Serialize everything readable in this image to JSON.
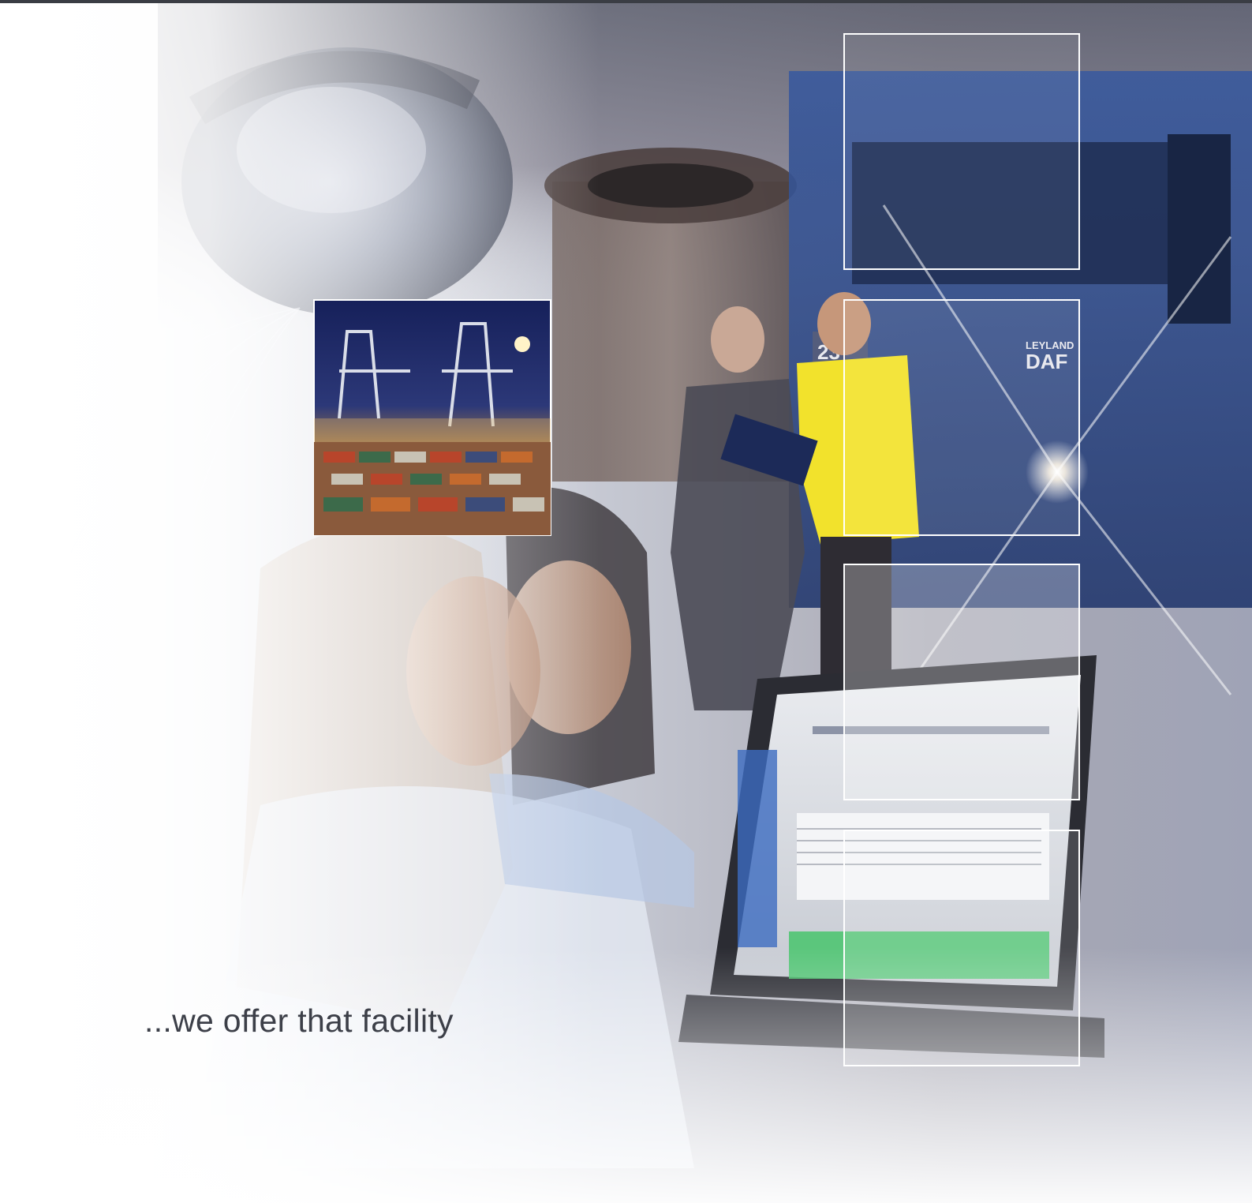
{
  "tagline": "...we offer that facility",
  "truck_badge": {
    "line1": "LEYLAND",
    "line2": "DAF"
  },
  "truck_number": "23",
  "photos": [
    "welder-photo",
    "container-port-photo",
    "truck-night-photo",
    "businessmen-photo",
    "office-workers-photo",
    "computer-monitor-photo"
  ],
  "colors": {
    "rule": "#3a3d44",
    "tagline": "#3c3f48",
    "truck_blue": "#3b5fa8",
    "jacket_yellow": "#f2e22c",
    "port_sky": "#1e2a63",
    "container_orange": "#b4562c"
  }
}
